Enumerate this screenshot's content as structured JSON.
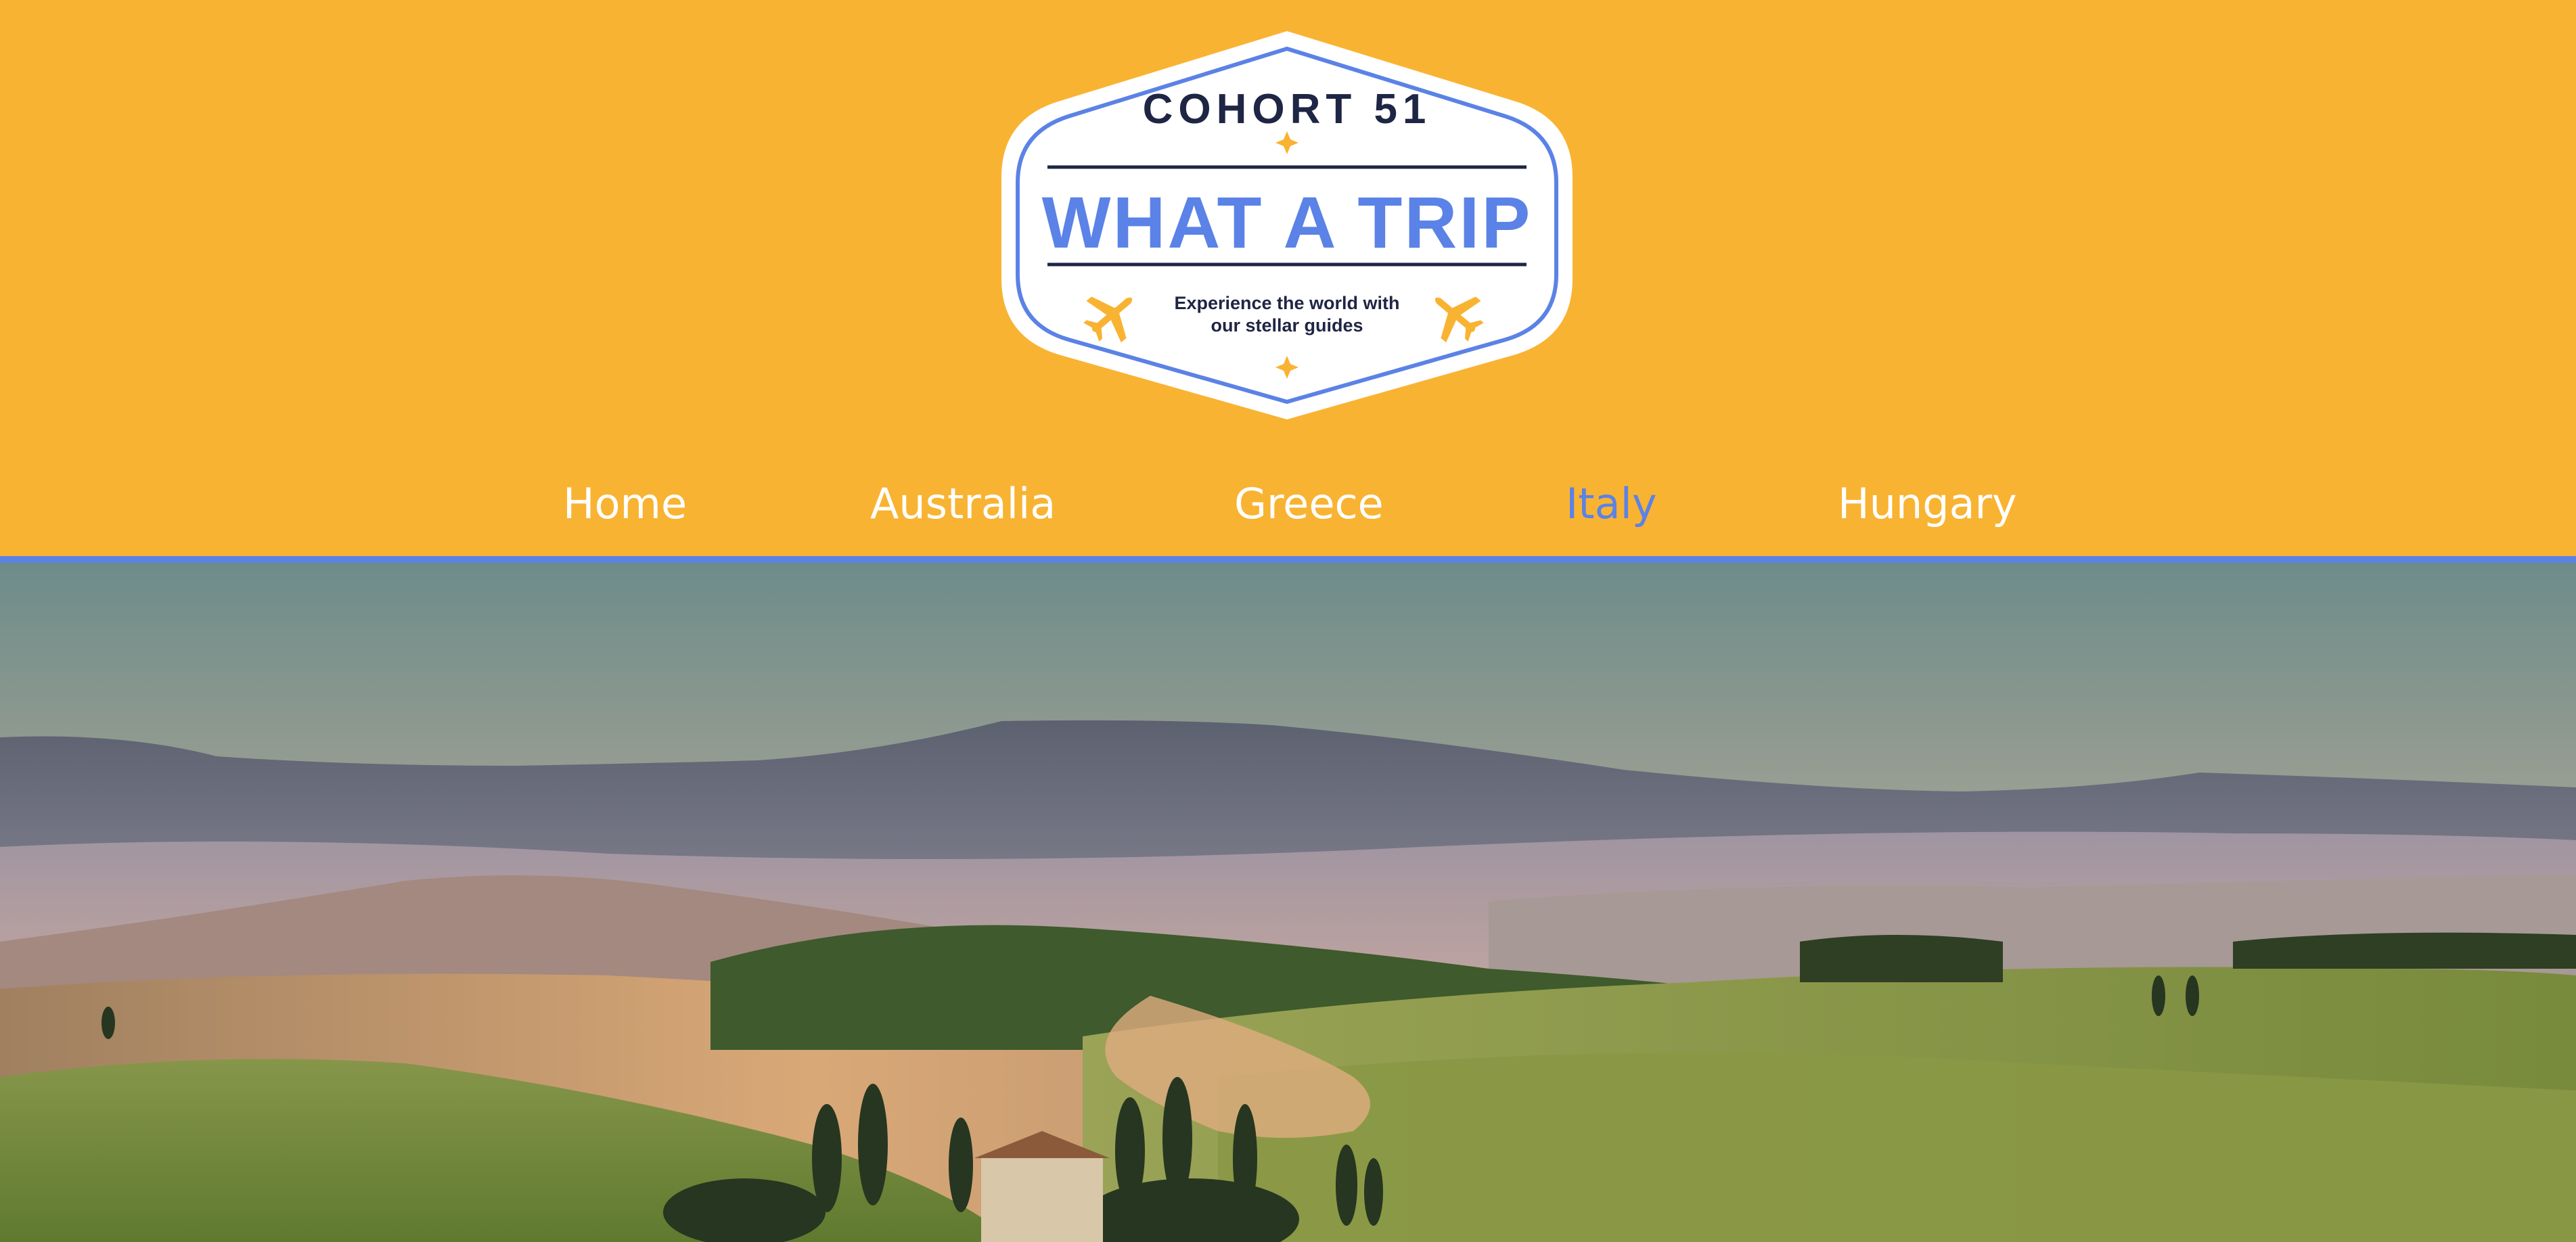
{
  "logo": {
    "cohort": "COHORT 51",
    "title": "WHAT A TRIP",
    "tagline_line1": "Experience the world with",
    "tagline_line2": "our stellar guides"
  },
  "nav": {
    "items": [
      {
        "label": "Home",
        "active": false
      },
      {
        "label": "Australia",
        "active": false
      },
      {
        "label": "Greece",
        "active": false
      },
      {
        "label": "Italy",
        "active": true
      },
      {
        "label": "Hungary",
        "active": false
      }
    ]
  },
  "hero": {
    "icon": "tuscany-landscape-image"
  },
  "colors": {
    "background": "#f9b332",
    "accent": "#5b82e6",
    "nav_text": "#ffffff",
    "logo_dark": "#1f2544"
  }
}
